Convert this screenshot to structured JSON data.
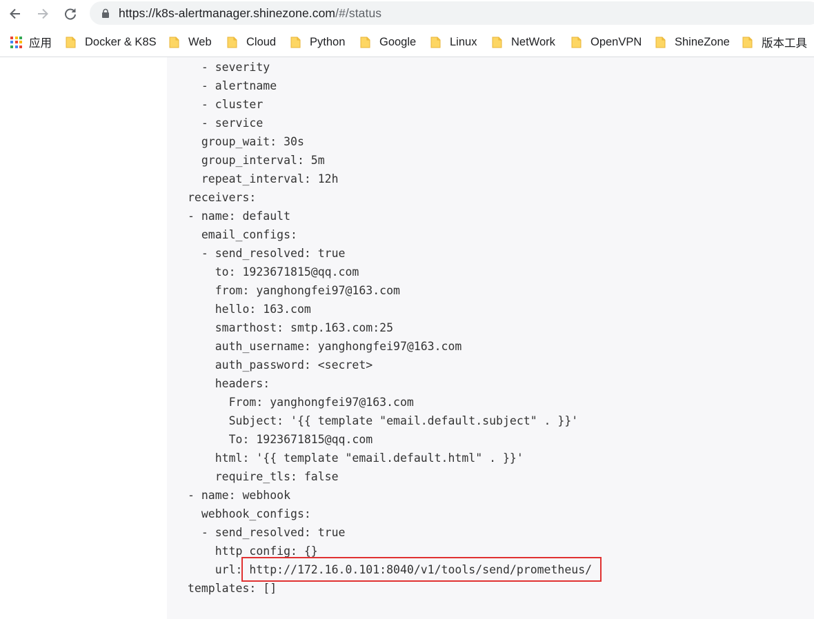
{
  "browser": {
    "url_host": "https://k8s-alertmanager.shinezone.com",
    "url_path": "/#/status"
  },
  "bookmarks": {
    "apps_label": "应用",
    "items": [
      {
        "label": "Docker & K8S"
      },
      {
        "label": "Web"
      },
      {
        "label": "Cloud"
      },
      {
        "label": "Python"
      },
      {
        "label": "Google"
      },
      {
        "label": "Linux"
      },
      {
        "label": "NetWork"
      },
      {
        "label": "OpenVPN"
      },
      {
        "label": "ShineZone"
      },
      {
        "label": "版本工具"
      }
    ]
  },
  "config": {
    "lines": [
      "  - severity",
      "  - alertname",
      "  - cluster",
      "  - service",
      "  group_wait: 30s",
      "  group_interval: 5m",
      "  repeat_interval: 12h",
      "receivers:",
      "- name: default",
      "  email_configs:",
      "  - send_resolved: true",
      "    to: 1923671815@qq.com",
      "    from: yanghongfei97@163.com",
      "    hello: 163.com",
      "    smarthost: smtp.163.com:25",
      "    auth_username: yanghongfei97@163.com",
      "    auth_password: <secret>",
      "    headers:",
      "      From: yanghongfei97@163.com",
      "      Subject: '{{ template \"email.default.subject\" . }}'",
      "      To: 1923671815@qq.com",
      "    html: '{{ template \"email.default.html\" . }}'",
      "    require_tls: false",
      "- name: webhook",
      "  webhook_configs:",
      "  - send_resolved: true",
      "    http_config: {}",
      "    url: http://172.16.0.101:8040/v1/tools/send/prometheus/",
      "templates: []"
    ]
  },
  "colors": {
    "highlight": "#e03131",
    "panel_bg": "#f7f7f9",
    "folder_yellow": "#fdd663"
  }
}
